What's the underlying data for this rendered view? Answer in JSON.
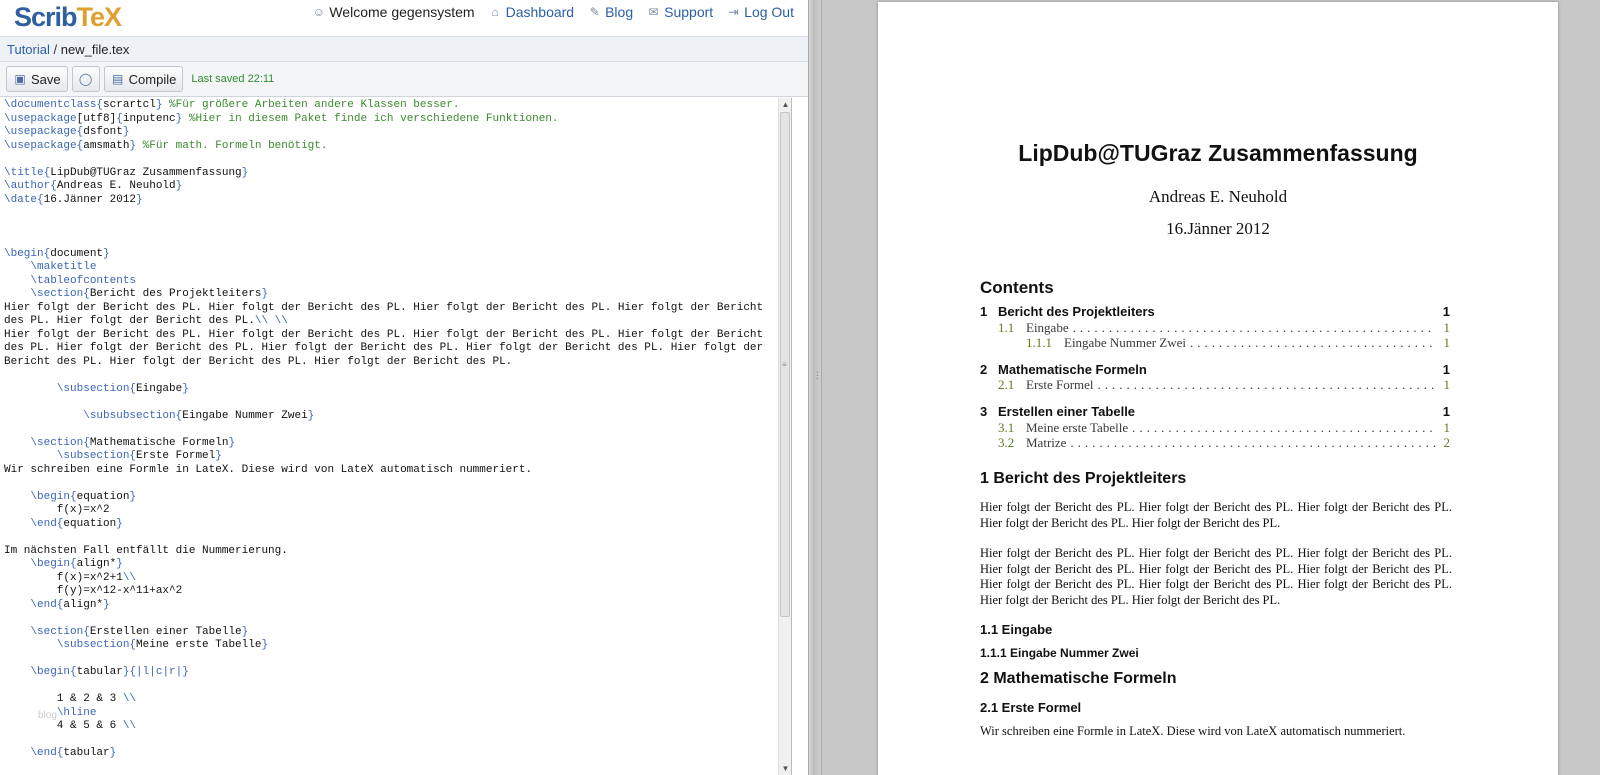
{
  "app": {
    "logo_part1": "Scrib",
    "logo_part2": "TeX"
  },
  "nav": {
    "welcome": "Welcome gegensystem",
    "dashboard": "Dashboard",
    "blog": "Blog",
    "support": "Support",
    "logout": "Log Out"
  },
  "breadcrumb": {
    "project": "Tutorial",
    "separator": "/",
    "file": "new_file.tex"
  },
  "toolbar": {
    "save": "Save",
    "compile": "Compile",
    "last_saved": "Last saved 22:11"
  },
  "editor": {
    "lines": [
      [
        [
          "cmd",
          "\\documentclass{"
        ],
        [
          "txt",
          "scrartcl"
        ],
        [
          "cmd",
          "}"
        ],
        [
          "com",
          " %Für größere Arbeiten andere Klassen besser."
        ]
      ],
      [
        [
          "cmd",
          "\\usepackage"
        ],
        [
          "txt",
          "[utf8]"
        ],
        [
          "cmd",
          "{"
        ],
        [
          "txt",
          "inputenc"
        ],
        [
          "cmd",
          "}"
        ],
        [
          "com",
          " %Hier in diesem Paket finde ich verschiedene Funktionen."
        ]
      ],
      [
        [
          "cmd",
          "\\usepackage{"
        ],
        [
          "txt",
          "dsfont"
        ],
        [
          "cmd",
          "}"
        ]
      ],
      [
        [
          "cmd",
          "\\usepackage{"
        ],
        [
          "txt",
          "amsmath"
        ],
        [
          "cmd",
          "}"
        ],
        [
          "com",
          " %Für math. Formeln benötigt."
        ]
      ],
      [],
      [
        [
          "cmd",
          "\\title{"
        ],
        [
          "txt",
          "LipDub@TUGraz Zusammenfassung"
        ],
        [
          "cmd",
          "}"
        ]
      ],
      [
        [
          "cmd",
          "\\author{"
        ],
        [
          "txt",
          "Andreas E. Neuhold"
        ],
        [
          "cmd",
          "}"
        ]
      ],
      [
        [
          "cmd",
          "\\date{"
        ],
        [
          "txt",
          "16.Jänner 2012"
        ],
        [
          "cmd",
          "}"
        ]
      ],
      [],
      [],
      [],
      [
        [
          "cmd",
          "\\begin{"
        ],
        [
          "txt",
          "document"
        ],
        [
          "cmd",
          "}"
        ]
      ],
      [
        [
          "txt",
          "    "
        ],
        [
          "cmd",
          "\\maketitle"
        ]
      ],
      [
        [
          "txt",
          "    "
        ],
        [
          "cmd",
          "\\tableofcontents"
        ]
      ],
      [
        [
          "txt",
          "    "
        ],
        [
          "cmd",
          "\\section{"
        ],
        [
          "txt",
          "Bericht des Projektleiters"
        ],
        [
          "cmd",
          "}"
        ]
      ],
      [
        [
          "txt",
          "Hier folgt der Bericht des PL. Hier folgt der Bericht des PL. Hier folgt der Bericht des PL. Hier folgt der Bericht"
        ]
      ],
      [
        [
          "txt",
          "des PL. Hier folgt der Bericht des PL."
        ],
        [
          "cmd",
          "\\\\ \\\\"
        ]
      ],
      [
        [
          "txt",
          "Hier folgt der Bericht des PL. Hier folgt der Bericht des PL. Hier folgt der Bericht des PL. Hier folgt der Bericht"
        ]
      ],
      [
        [
          "txt",
          "des PL. Hier folgt der Bericht des PL. Hier folgt der Bericht des PL. Hier folgt der Bericht des PL. Hier folgt der"
        ]
      ],
      [
        [
          "txt",
          "Bericht des PL. Hier folgt der Bericht des PL. Hier folgt der Bericht des PL."
        ]
      ],
      [],
      [
        [
          "txt",
          "        "
        ],
        [
          "cmd",
          "\\subsection{"
        ],
        [
          "txt",
          "Eingabe"
        ],
        [
          "cmd",
          "}"
        ]
      ],
      [],
      [
        [
          "txt",
          "            "
        ],
        [
          "cmd",
          "\\subsubsection{"
        ],
        [
          "txt",
          "Eingabe Nummer Zwei"
        ],
        [
          "cmd",
          "}"
        ]
      ],
      [],
      [
        [
          "txt",
          "    "
        ],
        [
          "cmd",
          "\\section{"
        ],
        [
          "txt",
          "Mathematische Formeln"
        ],
        [
          "cmd",
          "}"
        ]
      ],
      [
        [
          "txt",
          "        "
        ],
        [
          "cmd",
          "\\subsection{"
        ],
        [
          "txt",
          "Erste Formel"
        ],
        [
          "cmd",
          "}"
        ]
      ],
      [
        [
          "txt",
          "Wir schreiben eine Formle in LateX. Diese wird von LateX automatisch nummeriert."
        ]
      ],
      [],
      [
        [
          "txt",
          "    "
        ],
        [
          "cmd",
          "\\begin{"
        ],
        [
          "txt",
          "equation"
        ],
        [
          "cmd",
          "}"
        ]
      ],
      [
        [
          "txt",
          "        f(x)=x^2"
        ]
      ],
      [
        [
          "txt",
          "    "
        ],
        [
          "cmd",
          "\\end{"
        ],
        [
          "txt",
          "equation"
        ],
        [
          "cmd",
          "}"
        ]
      ],
      [],
      [
        [
          "txt",
          "Im nächsten Fall entfällt die Nummerierung."
        ]
      ],
      [
        [
          "txt",
          "    "
        ],
        [
          "cmd",
          "\\begin{"
        ],
        [
          "txt",
          "align*"
        ],
        [
          "cmd",
          "}"
        ]
      ],
      [
        [
          "txt",
          "        f(x)=x^2+1"
        ],
        [
          "cmd",
          "\\\\"
        ]
      ],
      [
        [
          "txt",
          "        f(y)=x^12-x^11+ax^2"
        ]
      ],
      [
        [
          "txt",
          "    "
        ],
        [
          "cmd",
          "\\end{"
        ],
        [
          "txt",
          "align*"
        ],
        [
          "cmd",
          "}"
        ]
      ],
      [],
      [
        [
          "txt",
          "    "
        ],
        [
          "cmd",
          "\\section{"
        ],
        [
          "txt",
          "Erstellen einer Tabelle"
        ],
        [
          "cmd",
          "}"
        ]
      ],
      [
        [
          "txt",
          "        "
        ],
        [
          "cmd",
          "\\subsection{"
        ],
        [
          "txt",
          "Meine erste Tabelle"
        ],
        [
          "cmd",
          "}"
        ]
      ],
      [],
      [
        [
          "txt",
          "    "
        ],
        [
          "cmd",
          "\\begin{"
        ],
        [
          "txt",
          "tabular"
        ],
        [
          "cmd",
          "}{|l|c|r|}"
        ]
      ],
      [],
      [
        [
          "txt",
          "        1 & 2 & 3 "
        ],
        [
          "cmd",
          "\\\\"
        ]
      ],
      [
        [
          "txt",
          "        "
        ],
        [
          "cmd",
          "\\hline"
        ]
      ],
      [
        [
          "txt",
          "        4 & 5 & 6 "
        ],
        [
          "cmd",
          "\\\\"
        ]
      ],
      [],
      [
        [
          "txt",
          "    "
        ],
        [
          "cmd",
          "\\end{"
        ],
        [
          "txt",
          "tabular"
        ],
        [
          "cmd",
          "}"
        ]
      ]
    ],
    "watermark": "blog"
  },
  "preview": {
    "title": "LipDub@TUGraz Zusammenfassung",
    "author": "Andreas E. Neuhold",
    "date": "16.Jänner 2012",
    "contents_heading": "Contents",
    "toc": [
      {
        "level": "section",
        "num": "1",
        "label": "Bericht des Projektleiters",
        "page": "1"
      },
      {
        "level": "subsection",
        "num": "1.1",
        "label": "Eingabe",
        "page": "1"
      },
      {
        "level": "subsubsection",
        "num": "1.1.1",
        "label": "Eingabe Nummer Zwei",
        "page": "1"
      },
      {
        "level": "section",
        "num": "2",
        "label": "Mathematische Formeln",
        "page": "1"
      },
      {
        "level": "subsection",
        "num": "2.1",
        "label": "Erste Formel",
        "page": "1"
      },
      {
        "level": "section",
        "num": "3",
        "label": "Erstellen einer Tabelle",
        "page": "1"
      },
      {
        "level": "subsection",
        "num": "3.1",
        "label": "Meine erste Tabelle",
        "page": "1"
      },
      {
        "level": "subsection",
        "num": "3.2",
        "label": "Matrize",
        "page": "2"
      }
    ],
    "section1_heading": "1  Bericht des Projektleiters",
    "para1": "Hier folgt der Bericht des PL. Hier folgt der Bericht des PL. Hier folgt der Bericht des PL. Hier folgt der Bericht des PL. Hier folgt der Bericht des PL.",
    "para2": "Hier folgt der Bericht des PL. Hier folgt der Bericht des PL. Hier folgt der Bericht des PL. Hier folgt der Bericht des PL. Hier folgt der Bericht des PL. Hier folgt der Bericht des PL. Hier folgt der Bericht des PL. Hier folgt der Bericht des PL. Hier folgt der Bericht des PL. Hier folgt der Bericht des PL. Hier folgt der Bericht des PL.",
    "sub11_heading": "1.1  Eingabe",
    "sub111_heading": "1.1.1  Eingabe Nummer Zwei",
    "section2_heading": "2  Mathematische Formeln",
    "sub21_heading": "2.1  Erste Formel",
    "para3": "Wir schreiben eine Formle in LateX. Diese wird von LateX automatisch nummeriert."
  }
}
